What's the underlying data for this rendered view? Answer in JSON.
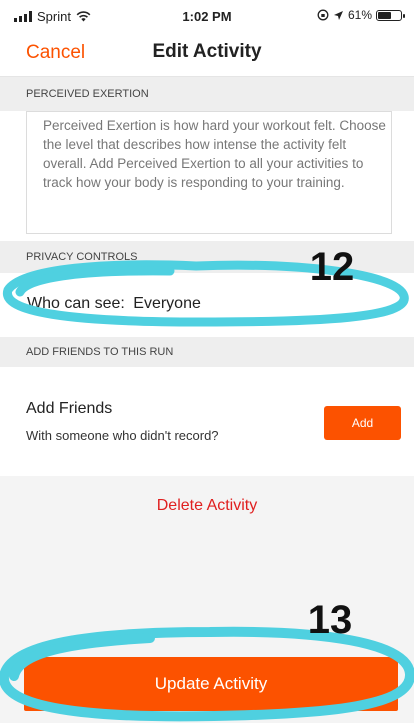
{
  "status_bar": {
    "carrier": "Sprint",
    "time": "1:02 PM",
    "battery": "61%",
    "battery_level": 0.61,
    "icons": [
      "signal-icon",
      "wifi-icon",
      "orientation-lock-icon",
      "location-arrow-icon",
      "battery-icon"
    ]
  },
  "nav": {
    "cancel_label": "Cancel",
    "title": "Edit Activity"
  },
  "perceived_exertion": {
    "header": "PERCEIVED EXERTION",
    "description": "Perceived Exertion is how hard your workout felt. Choose the level that describes how intense the activity felt overall. Add Perceived Exertion to all your activities to track how your body is responding to your training."
  },
  "privacy": {
    "header": "PRIVACY CONTROLS",
    "who_label": "Who can see:",
    "who_value": "Everyone"
  },
  "friends": {
    "header": "ADD FRIENDS TO THIS RUN",
    "title": "Add Friends",
    "subtitle": "With someone who didn't record?",
    "add_label": "Add"
  },
  "delete_label": "Delete Activity",
  "update_label": "Update Activity",
  "annotations": {
    "mark_12": "12",
    "mark_13": "13"
  },
  "colors": {
    "accent": "#fc5200",
    "delete": "#e02020",
    "highlight": "#4fd0e0"
  }
}
